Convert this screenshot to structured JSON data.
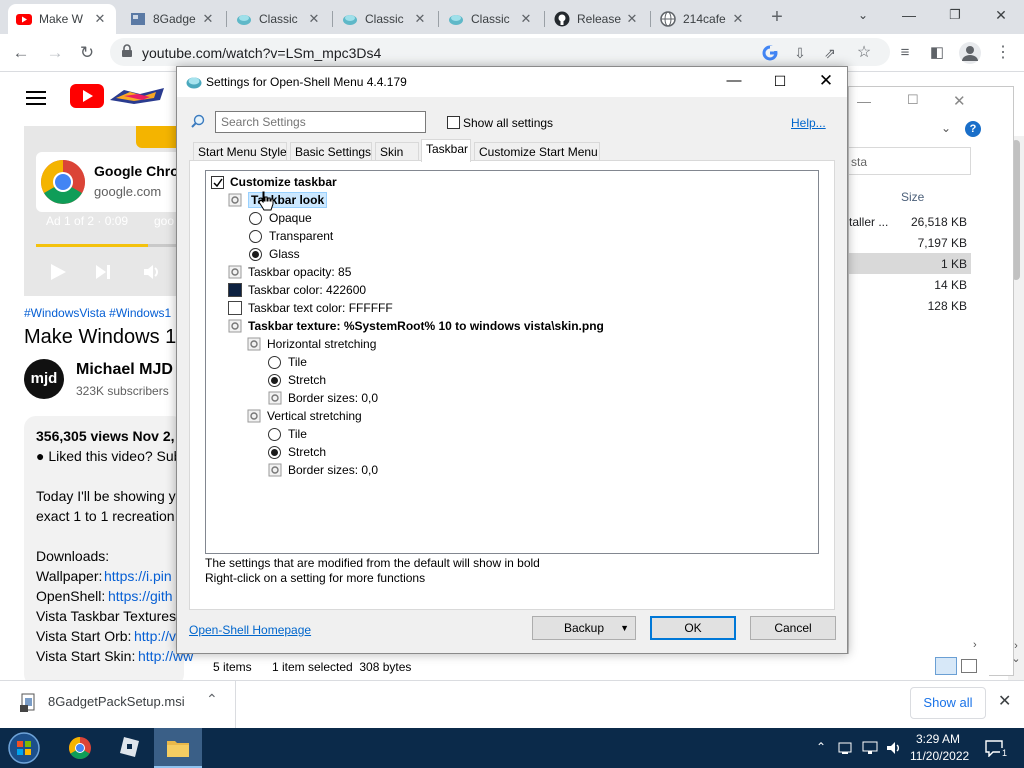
{
  "browser": {
    "tabs": [
      {
        "title": "Make W",
        "icon": "youtube-icon",
        "active": true
      },
      {
        "title": "8Gadge",
        "icon": "generic-tab-icon",
        "active": false
      },
      {
        "title": "Classic",
        "icon": "shell-icon",
        "active": false
      },
      {
        "title": "Classic",
        "icon": "shell-icon",
        "active": false
      },
      {
        "title": "Classic",
        "icon": "shell-icon",
        "active": false
      },
      {
        "title": "Release",
        "icon": "github-icon",
        "active": false
      },
      {
        "title": "214cafe",
        "icon": "globe-icon",
        "active": false
      }
    ],
    "url": "youtube.com/watch?v=LSm_mpc3Ds4"
  },
  "youtube": {
    "ad_title": "Google Chro",
    "ad_domain": "google.com",
    "ad_info": "Ad 1 of 2 · 0:09",
    "ad_info_trail": "goo",
    "hashtags": "#WindowsVista #Windows1",
    "video_title": "Make Windows 10",
    "channel_avatar": "mjd",
    "channel_name": "Michael MJD",
    "subscribers": "323K subscribers",
    "views": "356,305 views  Nov 2,",
    "desc_line1": "● Liked this video? Sub",
    "desc_line2": "Today I'll be showing y",
    "desc_line3": "exact 1 to 1 recreation",
    "downloads_label": "Downloads:",
    "dl1_label": "Wallpaper:",
    "dl1_link": "https://i.pin",
    "dl2_label": "OpenShell:",
    "dl2_link": "https://gith",
    "dl3_label": "Vista Taskbar Textures",
    "dl4_label": "Vista Start Orb:",
    "dl4_link": "http://v",
    "dl5_label": "Vista Start Skin:",
    "dl5_link": "http://ww"
  },
  "explorer": {
    "search_placeholder": "sta",
    "col_size": "Size",
    "rows": [
      {
        "name": "taller ...",
        "size": "26,518 KB"
      },
      {
        "name": "",
        "size": "7,197 KB"
      },
      {
        "name": "",
        "size": "1 KB"
      },
      {
        "name": "",
        "size": "14 KB"
      },
      {
        "name": "",
        "size": "128 KB"
      }
    ],
    "status_items": "5 items",
    "status_selected": "1 item selected  308 bytes"
  },
  "dialog": {
    "title": "Settings for Open-Shell Menu 4.4.179",
    "search_placeholder": "Search Settings",
    "show_all_label": "Show all settings",
    "help_link": "Help...",
    "tabs": [
      "Start Menu Style",
      "Basic Settings",
      "Skin",
      "Taskbar",
      "Customize Start Menu"
    ],
    "selected_tab": "Taskbar",
    "tree": {
      "customize_taskbar": "Customize taskbar",
      "taskbar_look": "Taskbar look",
      "opaque": "Opaque",
      "transparent": "Transparent",
      "glass": "Glass",
      "opacity": "Taskbar opacity: 85",
      "color": "Taskbar color: 422600",
      "text_color": "Taskbar text color: FFFFFF",
      "texture": "Taskbar texture: %SystemRoot% 10 to windows vista\\skin.png",
      "horizontal": "Horizontal stretching",
      "h_tile": "Tile",
      "h_stretch": "Stretch",
      "h_border": "Border sizes: 0,0",
      "vertical": "Vertical stretching",
      "v_tile": "Tile",
      "v_stretch": "Stretch",
      "v_border": "Border sizes: 0,0"
    },
    "swatch_color": "#0d2140",
    "text_swatch_color": "#ffffff",
    "note1": "The settings that are modified from the default will show in bold",
    "note2": "Right-click on a setting for more functions",
    "homepage_link": "Open-Shell Homepage",
    "backup_label": "Backup",
    "ok_label": "OK",
    "cancel_label": "Cancel"
  },
  "downloads": {
    "file": "8GadgetPackSetup.msi",
    "show_all": "Show all"
  },
  "taskbar": {
    "time": "3:29 AM",
    "date": "11/20/2022",
    "notifications": "1"
  }
}
